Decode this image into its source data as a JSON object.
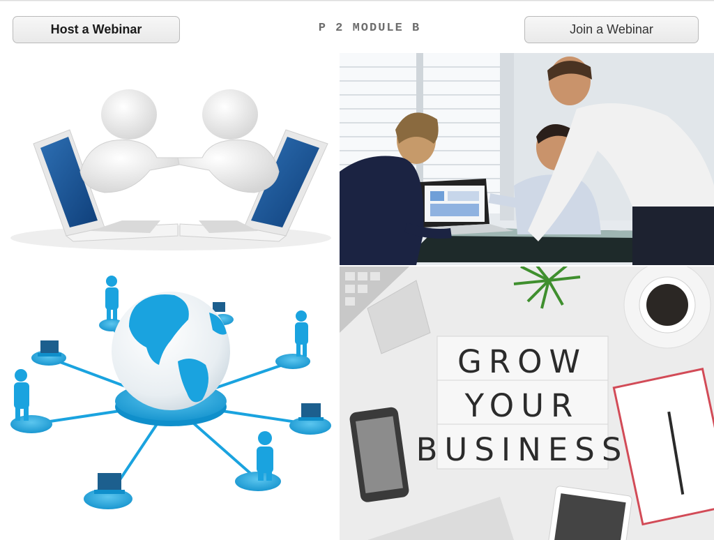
{
  "header": {
    "host_button_label": "Host a Webinar",
    "title": "P 2 MODULE B",
    "join_button_label": "Join a Webinar"
  },
  "images": {
    "laptop_handshake": {
      "icon": "handshake-laptops-illustration"
    },
    "meeting_photo": {
      "icon": "business-meeting-photo"
    },
    "globe_network": {
      "icon": "globe-network-illustration"
    },
    "grow_business": {
      "icon": "lightbox-desk-photo",
      "lightbox_lines": [
        "GROW",
        "YOUR",
        "BUSINESS"
      ]
    }
  },
  "colors": {
    "network_blue": "#1aa3df",
    "button_border": "#b9b9b9",
    "title_gray": "#6d6d6d"
  }
}
